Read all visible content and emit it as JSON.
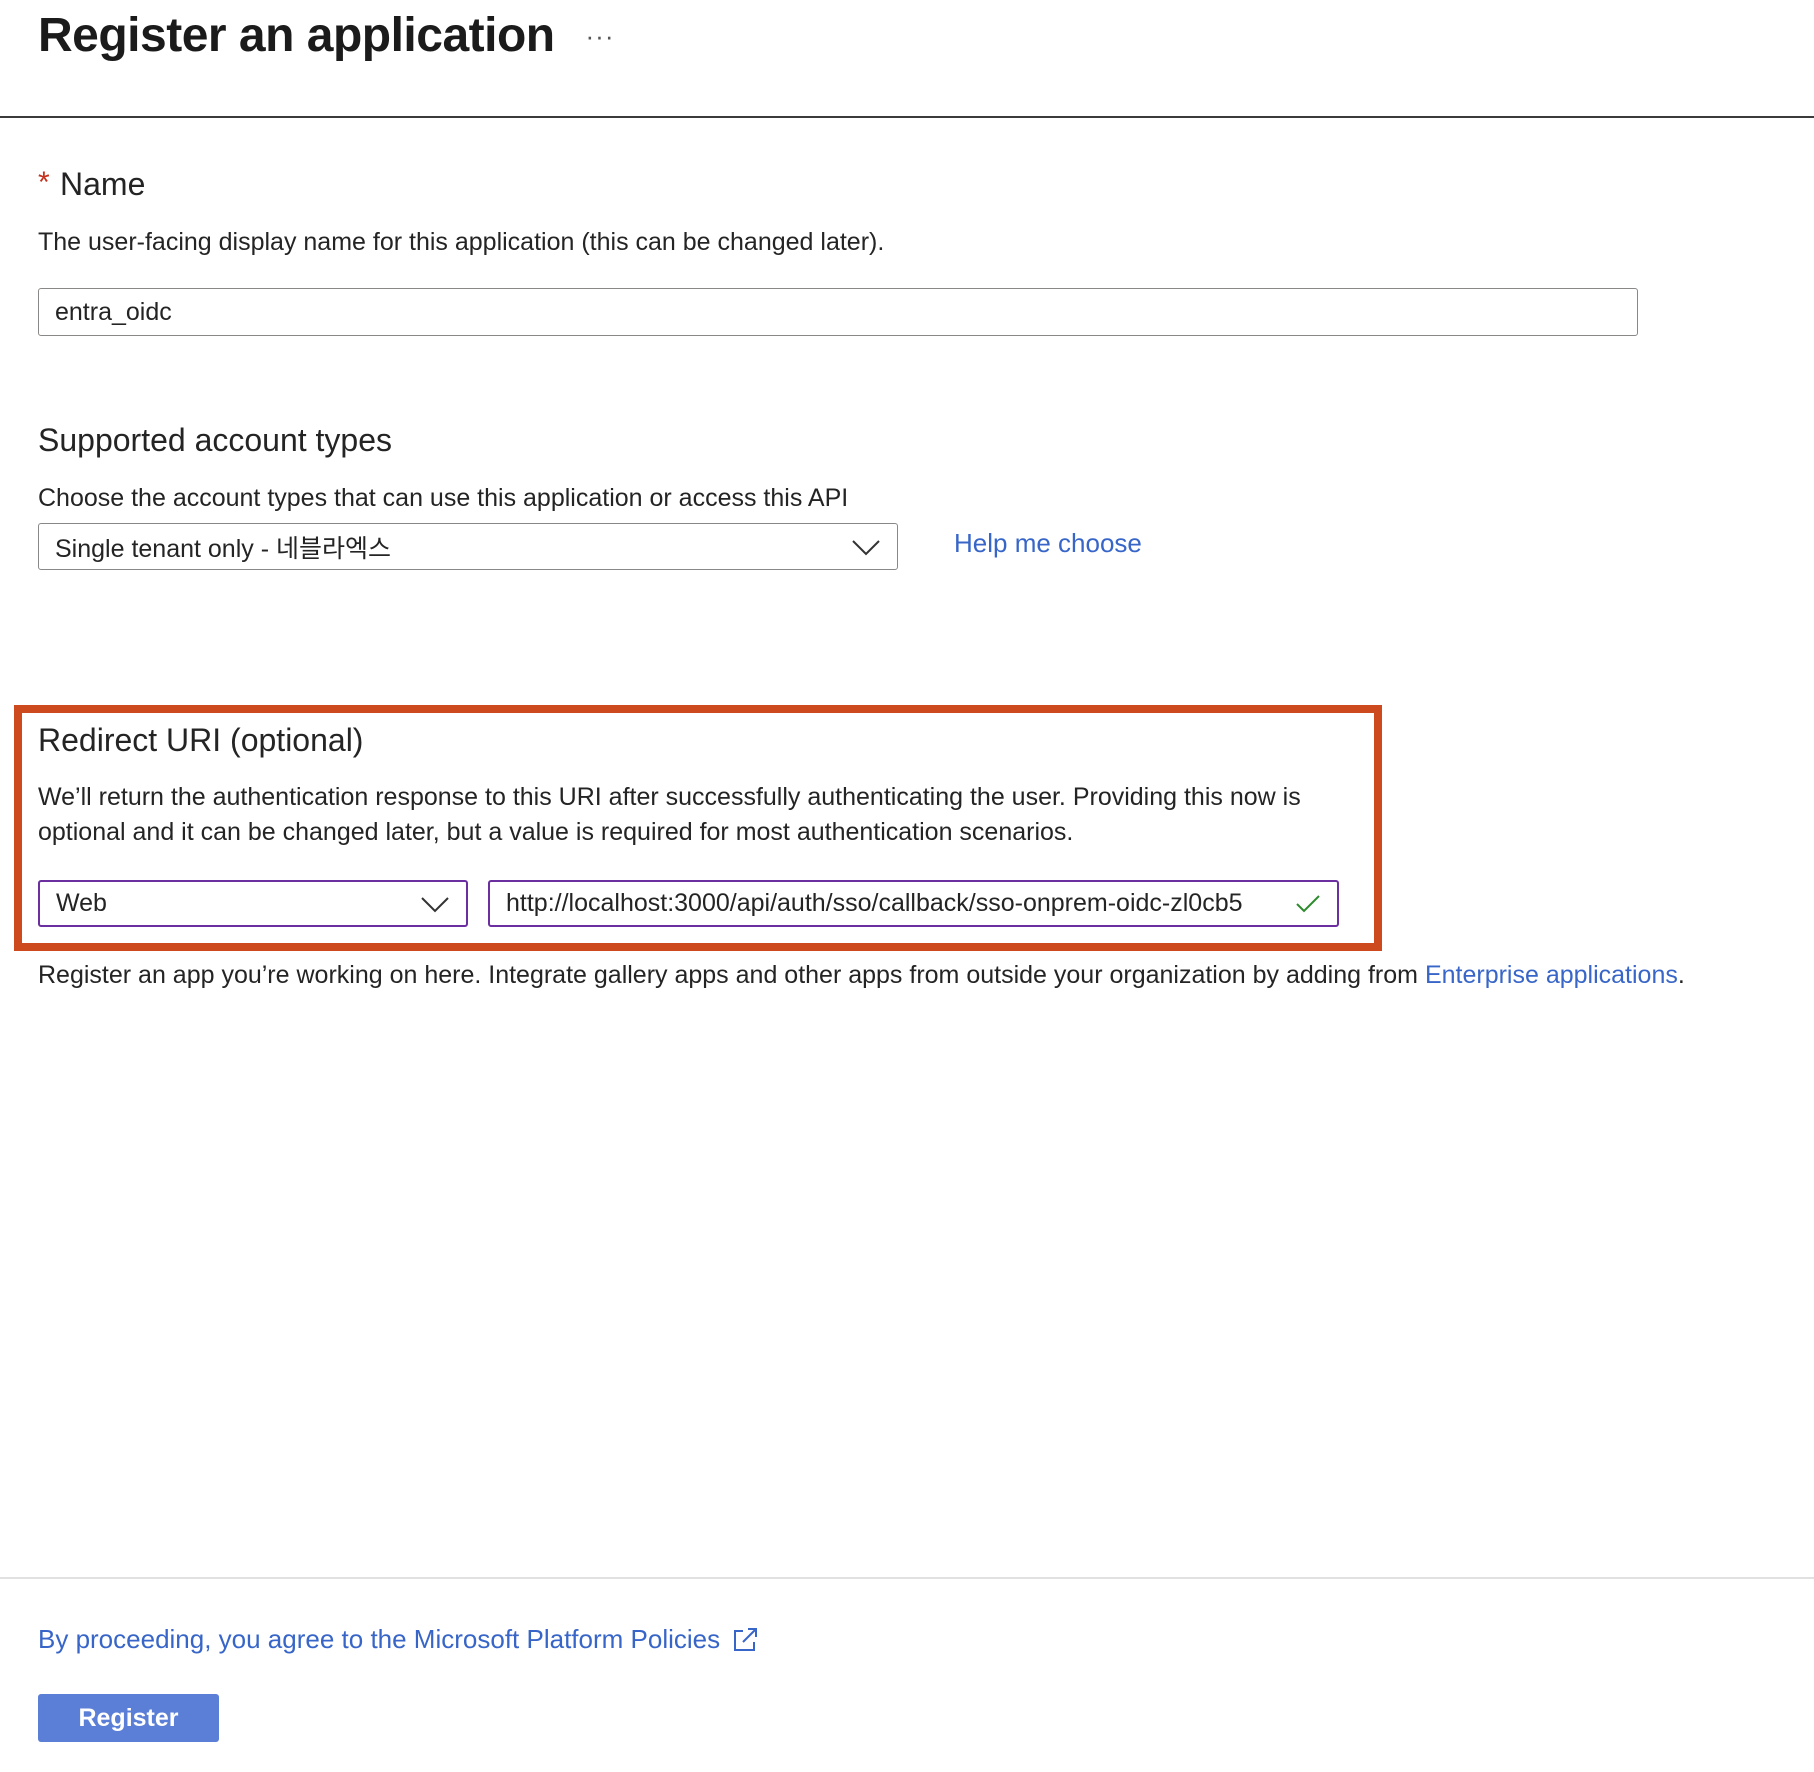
{
  "header": {
    "title": "Register an application",
    "more_label": "···"
  },
  "name_section": {
    "required_mark": "*",
    "heading": "Name",
    "description": "The user-facing display name for this application (this can be changed later).",
    "input_value": "entra_oidc"
  },
  "account_types": {
    "heading": "Supported account types",
    "description": "Choose the account types that can use this application or access this API",
    "selected": "Single tenant only - 네블라엑스",
    "help_link": "Help me choose"
  },
  "redirect_uri": {
    "heading": "Redirect URI (optional)",
    "description_line1": "We’ll return the authentication response to this URI after successfully authenticating the user. Providing this now is",
    "description_line2": "optional and it can be changed later, but a value is required for most authentication scenarios.",
    "platform_selected": "Web",
    "uri_value": "http://localhost:3000/api/auth/sso/callback/sso-onprem-oidc-zl0cb5",
    "highlight_color": "#cc4a1e",
    "valid_color": "#2e8b2e"
  },
  "info_text": {
    "prefix": "Register an app you’re working on here. Integrate gallery apps and other apps from outside your organization by adding from ",
    "link": "Enterprise applications",
    "suffix": "."
  },
  "footer": {
    "policy_link": "By proceeding, you agree to the Microsoft Platform Policies",
    "register_label": "Register"
  },
  "colors": {
    "link": "#3866c8",
    "primary_button": "#5b7fd6",
    "required": "#c4311c",
    "focus_border": "#6b2fa0"
  }
}
